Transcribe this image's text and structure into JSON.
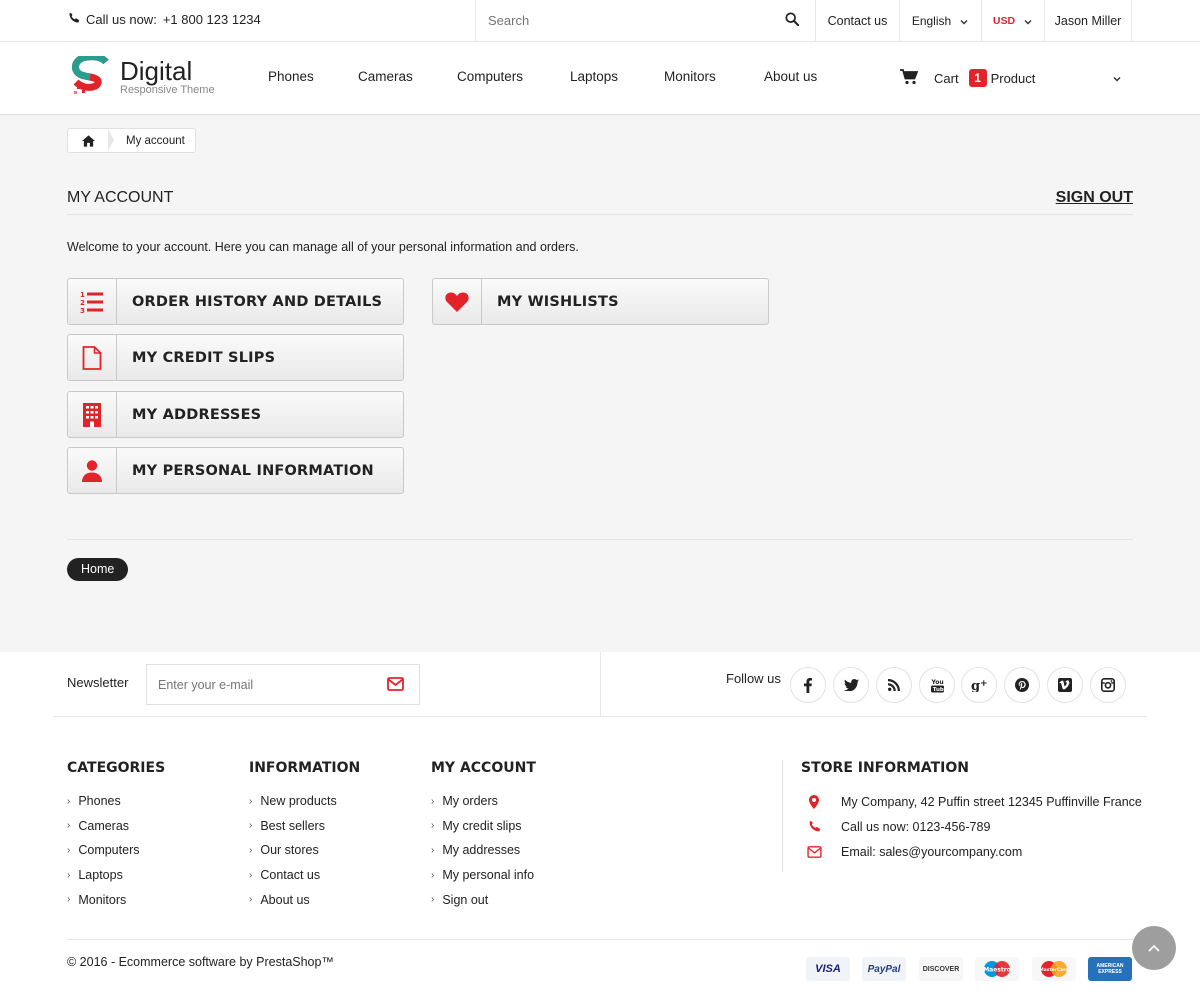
{
  "topbar": {
    "call_label": "Call us now:",
    "phone": "+1 800 123 1234",
    "search_placeholder": "Search",
    "contact": "Contact us",
    "language": "English",
    "currency": "USD",
    "user": "Jason Miller"
  },
  "header": {
    "logo_name": "Digital",
    "logo_tagline": "Responsive Theme",
    "nav": [
      "Phones",
      "Cameras",
      "Computers",
      "Laptops",
      "Monitors",
      "About us"
    ],
    "cart_label": "Cart",
    "cart_count": "1",
    "cart_unit": "Product"
  },
  "main": {
    "breadcrumb_current": "My account",
    "title": "MY ACCOUNT",
    "sign_out": "SIGN OUT",
    "welcome": "Welcome to your account. Here you can manage all of your personal information and orders.",
    "links": {
      "orders": "ORDER HISTORY AND DETAILS",
      "credit_slips": "MY CREDIT SLIPS",
      "addresses": "MY ADDRESSES",
      "personal": "MY PERSONAL INFORMATION",
      "wishlists": "MY WISHLISTS"
    },
    "home_button": "Home"
  },
  "newsletter": {
    "label": "Newsletter",
    "placeholder": "Enter your e-mail",
    "follow": "Follow us"
  },
  "footer": {
    "categories": {
      "title": "CATEGORIES",
      "items": [
        "Phones",
        "Cameras",
        "Computers",
        "Laptops",
        "Monitors"
      ]
    },
    "information": {
      "title": "INFORMATION",
      "items": [
        "New products",
        "Best sellers",
        "Our stores",
        "Contact us",
        "About us"
      ]
    },
    "account": {
      "title": "MY ACCOUNT",
      "items": [
        "My orders",
        "My credit slips",
        "My addresses",
        "My personal info",
        "Sign out"
      ]
    },
    "store": {
      "title": "STORE INFORMATION",
      "address": "My Company, 42 Puffin street 12345 Puffinville France",
      "phone": "Call us now: 0123-456-789",
      "email": "Email: sales@yourcompany.com"
    },
    "copyright": "© 2016 - Ecommerce software by PrestaShop™",
    "payments": [
      "VISA",
      "PayPal",
      "DISCOVER",
      "Maestro",
      "MasterCard",
      "AMERICAN EXPRESS"
    ]
  },
  "colors": {
    "accent": "#e2242a",
    "main_bg": "#f5f5f5",
    "dark": "#222222"
  }
}
